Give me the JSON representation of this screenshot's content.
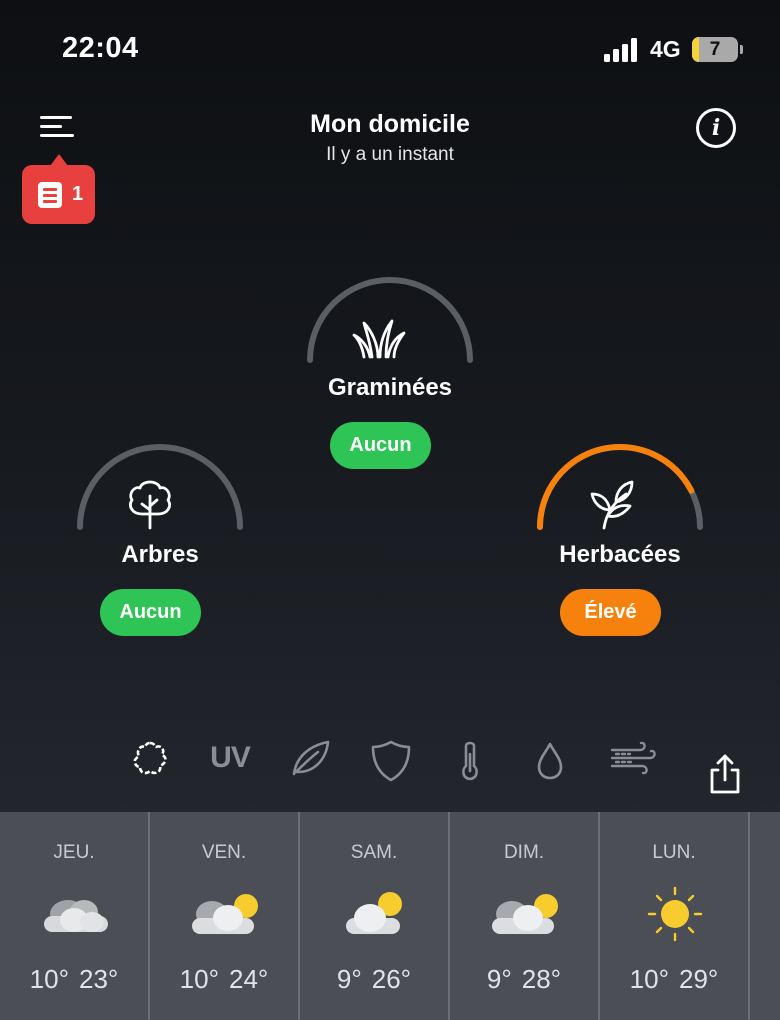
{
  "status": {
    "time": "22:04",
    "network": "4G",
    "battery": "7"
  },
  "header": {
    "title": "Mon domicile",
    "subtitle": "Il y a un instant",
    "badge_count": "1"
  },
  "pollen": [
    {
      "label": "Graminées",
      "level": "Aucun",
      "level_color": "#2ec556",
      "gauge_fraction": 0,
      "icon": "grass-icon"
    },
    {
      "label": "Arbres",
      "level": "Aucun",
      "level_color": "#2ec556",
      "gauge_fraction": 0,
      "icon": "tree-icon"
    },
    {
      "label": "Herbacées",
      "level": "Élevé",
      "level_color": "#f6820d",
      "gauge_fraction": 0.85,
      "icon": "plant-icon"
    }
  ],
  "tabs": [
    {
      "icon": "pollen-icon",
      "active": true
    },
    {
      "label": "UV"
    },
    {
      "icon": "leaf-icon"
    },
    {
      "icon": "shield-icon"
    },
    {
      "icon": "thermometer-icon"
    },
    {
      "icon": "drop-icon"
    },
    {
      "icon": "wind-icon"
    }
  ],
  "forecast": [
    {
      "day": "JEU.",
      "min": "10°",
      "max": "23°",
      "icon": "cloudy-icon"
    },
    {
      "day": "VEN.",
      "min": "10°",
      "max": "24°",
      "icon": "partly-cloudy-icon"
    },
    {
      "day": "SAM.",
      "min": "9°",
      "max": "26°",
      "icon": "partly-cloudy-icon"
    },
    {
      "day": "DIM.",
      "min": "9°",
      "max": "28°",
      "icon": "partly-cloudy-icon"
    },
    {
      "day": "LUN.",
      "min": "10°",
      "max": "29°",
      "icon": "sunny-icon"
    }
  ],
  "colors": {
    "accent_green": "#2ec556",
    "accent_orange": "#f6820d",
    "gauge_track": "#5b5e63",
    "badge_red": "#e8403e"
  }
}
